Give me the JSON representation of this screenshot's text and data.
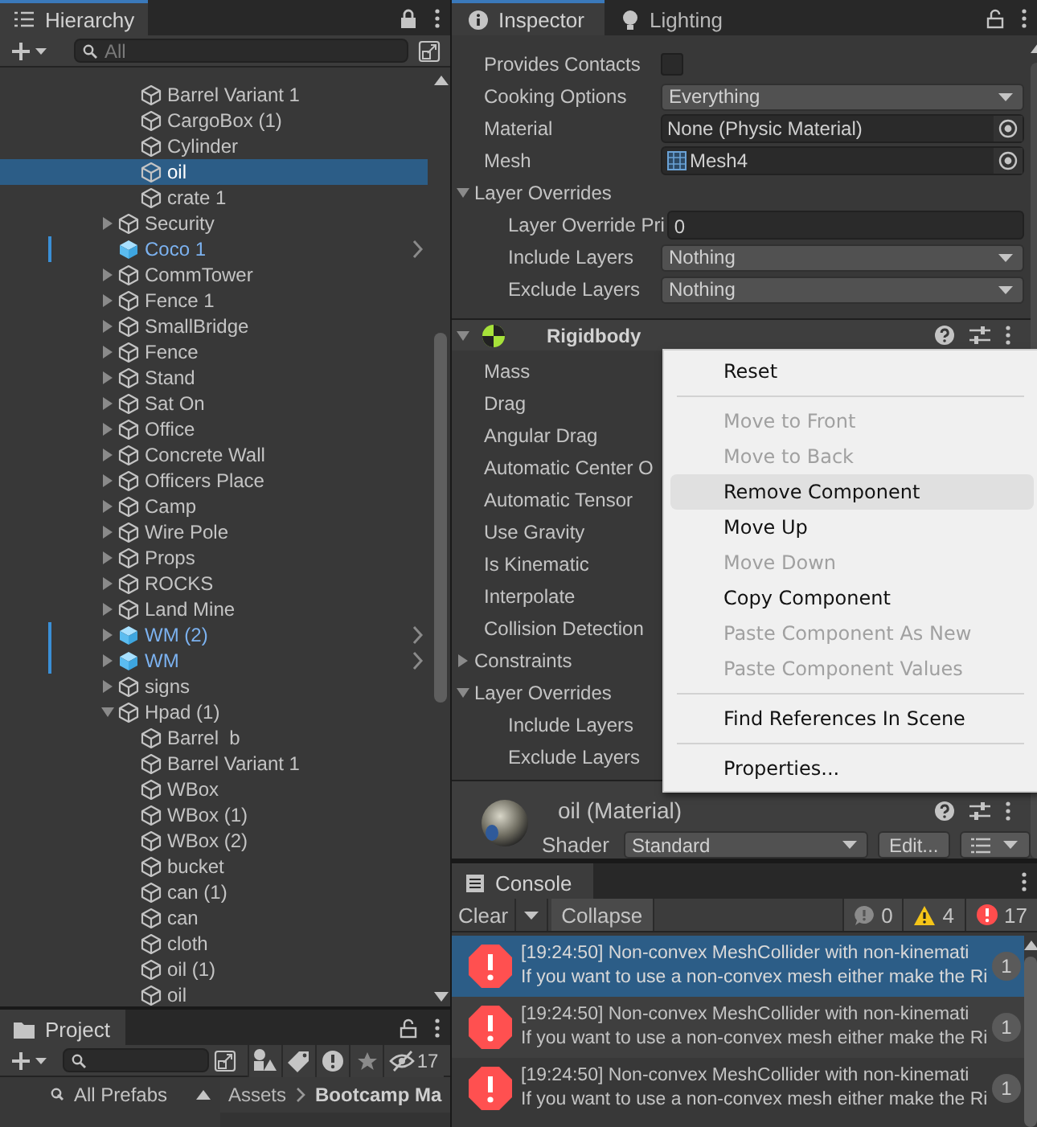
{
  "hierarchy": {
    "title": "Hierarchy",
    "search": {
      "placeholder": "All"
    },
    "continued_children": [
      {
        "label": "Barrel Variant 1",
        "selected": false,
        "prefab": false
      },
      {
        "label": "CargoBox (1)",
        "selected": false,
        "prefab": false
      },
      {
        "label": "Cylinder",
        "selected": false,
        "prefab": false
      },
      {
        "label": "oil",
        "selected": true,
        "prefab": false
      },
      {
        "label": "crate 1",
        "selected": false,
        "prefab": false
      }
    ],
    "items": [
      {
        "label": "Security",
        "selected": false,
        "prefab": false,
        "expanded": false
      },
      {
        "label": "Coco 1",
        "selected": false,
        "prefab": true
      },
      {
        "label": "CommTower",
        "selected": false,
        "prefab": false,
        "expanded": false
      },
      {
        "label": "Fence 1",
        "selected": false,
        "prefab": false,
        "expanded": false
      },
      {
        "label": "SmallBridge",
        "selected": false,
        "prefab": false,
        "expanded": false
      },
      {
        "label": "Fence",
        "selected": false,
        "prefab": false,
        "expanded": false
      },
      {
        "label": "Stand",
        "selected": false,
        "prefab": false,
        "expanded": false
      },
      {
        "label": "Sat On",
        "selected": false,
        "prefab": false,
        "expanded": false
      },
      {
        "label": "Office",
        "selected": false,
        "prefab": false,
        "expanded": false
      },
      {
        "label": "Concrete Wall",
        "selected": false,
        "prefab": false,
        "expanded": false
      },
      {
        "label": "Officers Place",
        "selected": false,
        "prefab": false,
        "expanded": false
      },
      {
        "label": "Camp",
        "selected": false,
        "prefab": false,
        "expanded": false
      },
      {
        "label": "Wire Pole",
        "selected": false,
        "prefab": false,
        "expanded": false
      },
      {
        "label": "Props",
        "selected": false,
        "prefab": false,
        "expanded": false
      },
      {
        "label": "ROCKS",
        "selected": false,
        "prefab": false,
        "expanded": false
      },
      {
        "label": "Land Mine",
        "selected": false,
        "prefab": false,
        "expanded": false
      },
      {
        "label": "WM (2)",
        "selected": false,
        "prefab": true,
        "expanded": false
      },
      {
        "label": "WM",
        "selected": false,
        "prefab": true,
        "expanded": false
      },
      {
        "label": "signs",
        "selected": false,
        "prefab": false,
        "expanded": false
      },
      {
        "label": "Hpad (1)",
        "selected": false,
        "prefab": false,
        "expanded": true,
        "children": [
          {
            "label": "Barrel  b",
            "selected": false,
            "prefab": false
          },
          {
            "label": "Barrel Variant 1",
            "selected": false,
            "prefab": false
          },
          {
            "label": "WBox",
            "selected": false,
            "prefab": false
          },
          {
            "label": "WBox (1)",
            "selected": false,
            "prefab": false
          },
          {
            "label": "WBox (2)",
            "selected": false,
            "prefab": false
          },
          {
            "label": "bucket",
            "selected": false,
            "prefab": false
          },
          {
            "label": "can (1)",
            "selected": false,
            "prefab": false
          },
          {
            "label": "can",
            "selected": false,
            "prefab": false
          },
          {
            "label": "cloth",
            "selected": false,
            "prefab": false
          },
          {
            "label": "oil (1)",
            "selected": false,
            "prefab": false
          },
          {
            "label": "oil",
            "selected": false,
            "prefab": false
          }
        ]
      }
    ]
  },
  "inspector": {
    "tabs": [
      {
        "label": "Inspector",
        "selected": true
      },
      {
        "label": "Lighting",
        "selected": false
      }
    ],
    "collider_rows": [
      {
        "kind": "checkbox",
        "label": "Provides Contacts",
        "checked": false
      },
      {
        "kind": "dropdown",
        "label": "Cooking Options",
        "value": "Everything"
      },
      {
        "kind": "object",
        "label": "Material",
        "value": "None (Physic Material)"
      },
      {
        "kind": "mesh_object",
        "label": "Mesh",
        "value": "Mesh4"
      },
      {
        "kind": "foldout",
        "label": "Layer Overrides",
        "expanded": true,
        "children": [
          {
            "kind": "number",
            "label": "Layer Override Pri",
            "value": "0"
          },
          {
            "kind": "dropdown",
            "label": "Include Layers",
            "value": "Nothing"
          },
          {
            "kind": "dropdown",
            "label": "Exclude Layers",
            "value": "Nothing"
          }
        ]
      }
    ],
    "rigidbody": {
      "title": "Rigidbody",
      "rows": [
        {
          "kind": "label",
          "label": "Mass"
        },
        {
          "kind": "label",
          "label": "Drag"
        },
        {
          "kind": "label",
          "label": "Angular Drag"
        },
        {
          "kind": "label",
          "label": "Automatic Center O"
        },
        {
          "kind": "label",
          "label": "Automatic Tensor"
        },
        {
          "kind": "label",
          "label": "Use Gravity"
        },
        {
          "kind": "label",
          "label": "Is Kinematic"
        },
        {
          "kind": "label",
          "label": "Interpolate"
        },
        {
          "kind": "label",
          "label": "Collision Detection"
        },
        {
          "kind": "foldout",
          "label": "Constraints",
          "expanded": false
        },
        {
          "kind": "foldout",
          "label": "Layer Overrides",
          "expanded": true,
          "children": [
            {
              "kind": "label",
              "label": "Include Layers"
            },
            {
              "kind": "label",
              "label": "Exclude Layers"
            }
          ]
        }
      ]
    },
    "material": {
      "name": "oil (Material)",
      "shader_label": "Shader",
      "shader": "Standard",
      "edit_button": "Edit..."
    }
  },
  "context_menu": [
    {
      "kind": "item",
      "label": "Reset",
      "disabled": false,
      "selected": false
    },
    {
      "kind": "separator"
    },
    {
      "kind": "item",
      "label": "Move to Front",
      "disabled": true,
      "selected": false
    },
    {
      "kind": "item",
      "label": "Move to Back",
      "disabled": true,
      "selected": false
    },
    {
      "kind": "item",
      "label": "Remove Component",
      "disabled": false,
      "selected": true
    },
    {
      "kind": "item",
      "label": "Move Up",
      "disabled": false,
      "selected": false
    },
    {
      "kind": "item",
      "label": "Move Down",
      "disabled": true,
      "selected": false
    },
    {
      "kind": "item",
      "label": "Copy Component",
      "disabled": false,
      "selected": false
    },
    {
      "kind": "item",
      "label": "Paste Component As New",
      "disabled": true,
      "selected": false
    },
    {
      "kind": "item",
      "label": "Paste Component Values",
      "disabled": true,
      "selected": false
    },
    {
      "kind": "separator"
    },
    {
      "kind": "item",
      "label": "Find References In Scene",
      "disabled": false,
      "selected": false
    },
    {
      "kind": "separator"
    },
    {
      "kind": "item",
      "label": "Properties...",
      "disabled": false,
      "selected": false
    }
  ],
  "console": {
    "title": "Console",
    "clear_button": "Clear",
    "collapse_button": "Collapse",
    "counts": {
      "info": "0",
      "warnings": "4",
      "errors": "17"
    },
    "entries": [
      {
        "line1": "[19:24:50] Non-convex MeshCollider with non-kinemati",
        "line2": "If you want to use a non-convex mesh either make the Ri",
        "count": "1",
        "selected": true
      },
      {
        "line1": "[19:24:50] Non-convex MeshCollider with non-kinemati",
        "line2": "If you want to use a non-convex mesh either make the Ri",
        "count": "1",
        "selected": false
      },
      {
        "line1": "[19:24:50] Non-convex MeshCollider with non-kinemati",
        "line2": "If you want to use a non-convex mesh either make the Ri",
        "count": "1",
        "selected": false
      }
    ]
  },
  "project": {
    "title": "Project",
    "hidden_count": "17",
    "favorite": "All Prefabs",
    "breadcrumb": [
      "Assets",
      "Bootcamp Ma"
    ]
  }
}
